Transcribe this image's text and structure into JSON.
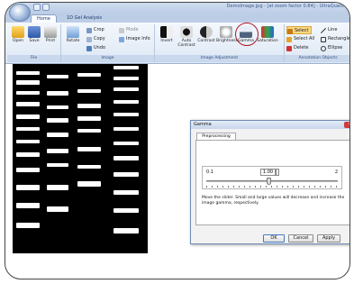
{
  "window": {
    "title": "DemoImage.jpg - [at zoom factor 0.84] - UltraQuant"
  },
  "tabs": [
    "Home",
    "1D Gel Analysis"
  ],
  "ribbon": {
    "file_group": {
      "label": "File",
      "buttons": [
        "Open",
        "Save",
        "Print"
      ]
    },
    "image_group": {
      "label": "Image",
      "rotate": "Rotate",
      "crop": "Crop",
      "copy": "Copy",
      "undo": "Undo",
      "mode": "Mode",
      "image_info": "Image Info"
    },
    "adjust_group": {
      "label": "Image Adjustment",
      "buttons": [
        "Invert",
        "Auto Contrast",
        "Contrast",
        "Brightness",
        "Gamma",
        "Saturation"
      ]
    },
    "annotation_group": {
      "label": "Annotation Objects",
      "select": "Select",
      "select_all": "Select All",
      "delete": "Delete",
      "line": "Line",
      "rectangle": "Rectangle",
      "ellipse": "Ellipse"
    }
  },
  "gamma_dialog": {
    "title": "Gamma",
    "tab": "Preprocessing",
    "min_label": "0.1",
    "max_label": "2",
    "value": "1.00",
    "slider_fraction": 0.47,
    "hint": "Move the slider. Small and large values will decrease and increase the image gamma, respectively.",
    "buttons": {
      "ok": "OK",
      "cancel": "Cancel",
      "apply": "Apply"
    }
  },
  "colors": {
    "accent_ring": "#b01a2a",
    "ribbon_bg": "#dde7f4",
    "gel_bg": "#000000"
  }
}
